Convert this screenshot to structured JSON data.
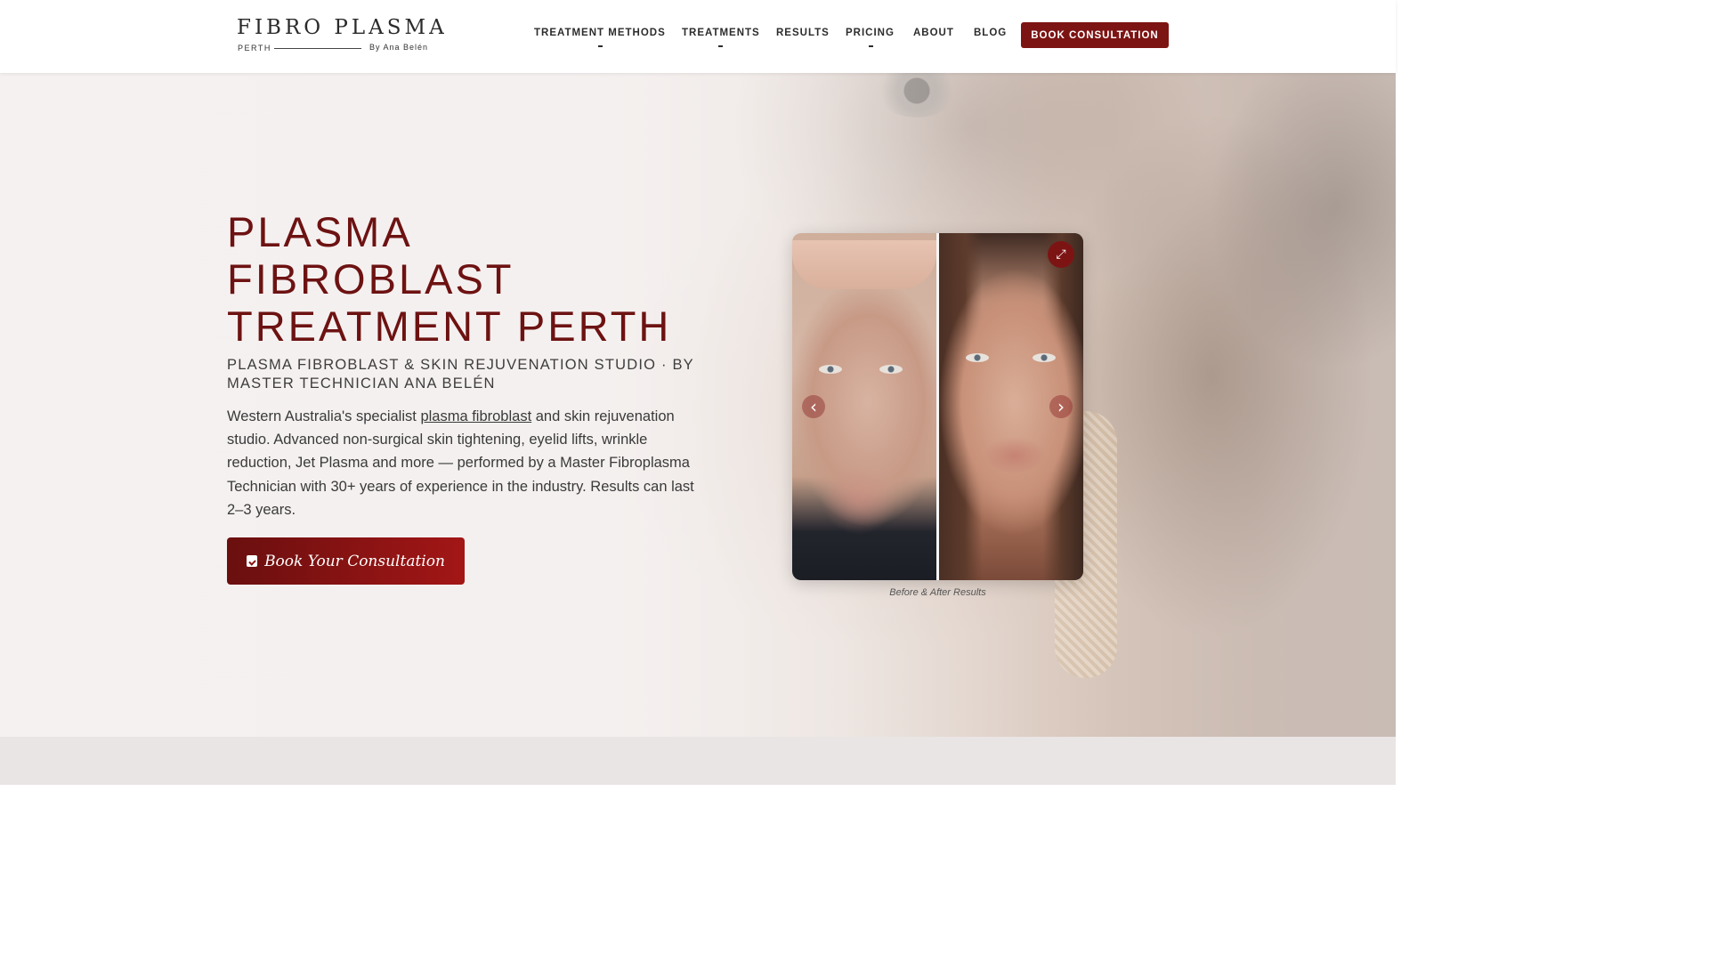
{
  "header": {
    "logo": {
      "main": "FIBRO PLASMA",
      "left_sub": "PERTH",
      "right_sub": "By Ana Belén"
    },
    "nav": [
      {
        "label": "TREATMENT METHODS",
        "has_dropdown": true
      },
      {
        "label": "TREATMENTS",
        "has_dropdown": true
      },
      {
        "label": "RESULTS",
        "has_dropdown": false
      },
      {
        "label": "PRICING",
        "has_dropdown": true
      },
      {
        "label": "ABOUT",
        "has_dropdown": false
      },
      {
        "label": "BLOG",
        "has_dropdown": false
      }
    ],
    "cta_label": "BOOK CONSULTATION"
  },
  "hero": {
    "title_lines": [
      "PLASMA",
      "FIBROBLAST",
      "TREATMENT PERTH"
    ],
    "subtitle": "PLASMA FIBROBLAST & SKIN REJUVENATION STUDIO · BY MASTER TECHNICIAN ANA BELÉN",
    "description_before": "Western Australia's specialist ",
    "description_link": "plasma fibroblast",
    "description_after": " and skin rejuvenation studio. Advanced non-surgical skin tightening, eyelid lifts, wrinkle reduction, Jet Plasma and more — performed by a Master Fibroplasma Technician with 30+ years of experience in the industry. Results can last 2–3 years.",
    "cta_label": "Book Your Consultation",
    "cta_icon": "calendar-check-icon"
  },
  "gallery": {
    "caption": "Before & After Results",
    "icons": {
      "expand": "expand-icon",
      "prev": "chevron-left-icon",
      "next": "chevron-right-icon"
    }
  },
  "colors": {
    "accent": "#7d1414",
    "title": "#6d1212",
    "hero_bg": "#f3efee",
    "section_bg": "#e9e5e4"
  }
}
